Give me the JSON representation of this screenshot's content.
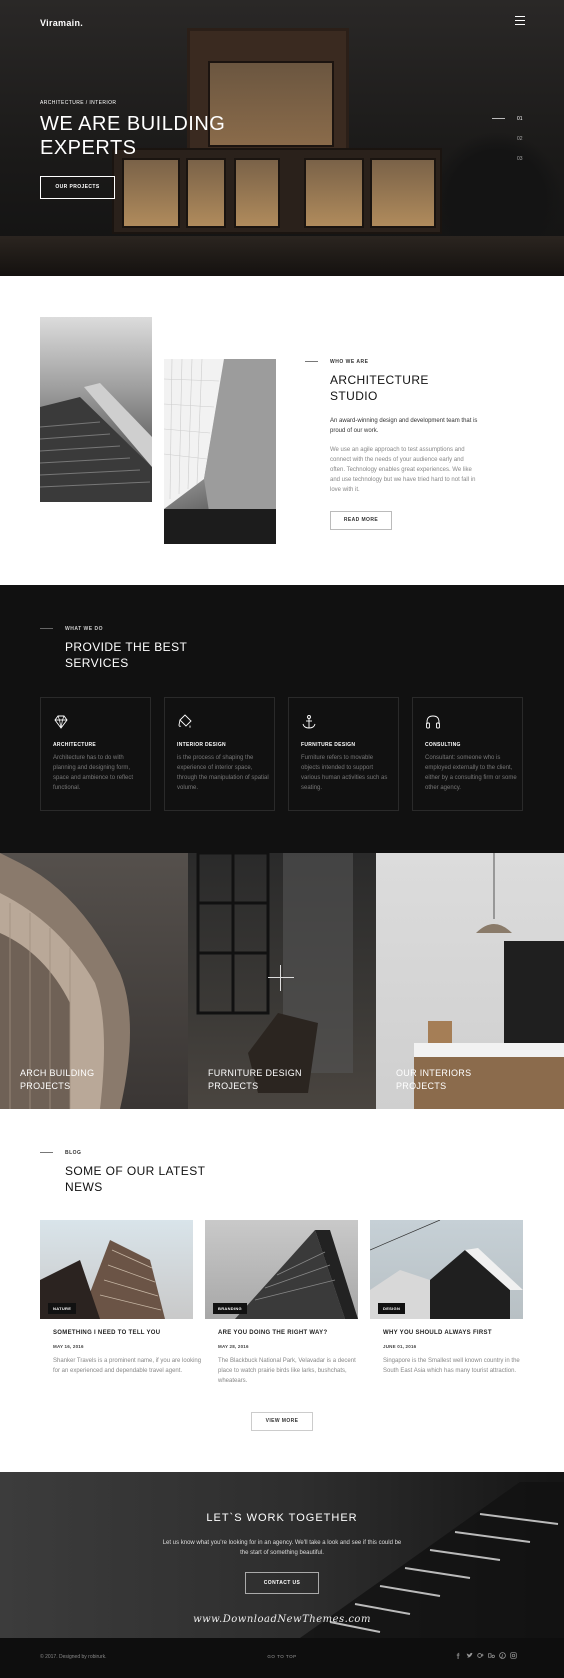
{
  "header": {
    "logo": "Viramain.",
    "menu_icon": "hamburger-menu-icon"
  },
  "hero": {
    "kicker": "ARCHITECTURE / INTERIOR",
    "title_line1": "WE ARE BUILDING",
    "title_line2": "EXPERTS",
    "button": "OUR PROJECTS",
    "pager": [
      "01",
      "02",
      "03"
    ]
  },
  "about": {
    "kicker": "WHO WE ARE",
    "title_line1": "ARCHITECTURE",
    "title_line2": "STUDIO",
    "lead": "An award-winning design and development team that is proud of our work.",
    "body": "We use an agile approach to test assumptions and connect with the needs of your audience early and often. Technology enables great experiences. We like and use technology but we have tried hard to not fall in love with it.",
    "button": "READ MORE"
  },
  "services": {
    "kicker": "WHAT WE DO",
    "title_line1": "PROVIDE THE BEST",
    "title_line2": "SERVICES",
    "items": [
      {
        "icon": "diamond-icon",
        "name": "ARCHITECTURE",
        "desc": "Architecture has to do with planning and designing form, space and ambience to reflect functional."
      },
      {
        "icon": "paint-bucket-icon",
        "name": "INTERIOR DESIGN",
        "desc": "is the process of shaping the experience of interior space, through the manipulation of spatial volume."
      },
      {
        "icon": "anchor-icon",
        "name": "FURNITURE DESIGN",
        "desc": "Furniture refers to movable objects intended to support various human activities such as seating."
      },
      {
        "icon": "headphones-icon",
        "name": "CONSULTING",
        "desc": "Consultant: someone who is employed externally to the client, either by a consulting firm or some other agency."
      }
    ]
  },
  "projects": [
    {
      "line1": "ARCH BUILDING",
      "line2": "PROJECTS"
    },
    {
      "line1": "FURNITURE DESIGN",
      "line2": "PROJECTS"
    },
    {
      "line1": "OUR INTERIORS",
      "line2": "PROJECTS"
    }
  ],
  "blog": {
    "kicker": "BLOG",
    "title_line1": "SOME OF OUR LATEST",
    "title_line2": "NEWS",
    "posts": [
      {
        "tag": "NATURE",
        "title": "SOMETHING I NEED TO TELL YOU",
        "date": "MAY 16, 2016",
        "excerpt": "Shanker Travels is a prominent name, if you are looking for an experienced and dependable travel agent."
      },
      {
        "tag": "BRANDING",
        "title": "ARE YOU DOING THE RIGHT WAY?",
        "date": "MAY 28, 2016",
        "excerpt": "The Blackbuck National Park, Velavadar is a decent place to watch prairie birds like larks, bushchats, wheatears."
      },
      {
        "tag": "DESIGN",
        "title": "WHY YOU SHOULD ALWAYS FIRST",
        "date": "JUNE 01, 2016",
        "excerpt": "Singapore is the Smallest well known country in the South East Asia which has many tourist attraction."
      }
    ],
    "view_more": "VIEW MORE"
  },
  "cta": {
    "title": "LET`S WORK TOGETHER",
    "text": "Let us know what you're looking for in an agency. We'll take a look and see if this could be the start of something beautiful.",
    "button": "CONTACT US",
    "watermark": "www.DownloadNewThemes.com"
  },
  "footer": {
    "copyright": "© 2017. Designed by robirurk.",
    "goto_top": "GO TO TOP",
    "social": [
      "facebook-icon",
      "twitter-icon",
      "google-plus-icon",
      "behance-icon",
      "pinterest-icon",
      "instagram-icon"
    ]
  }
}
